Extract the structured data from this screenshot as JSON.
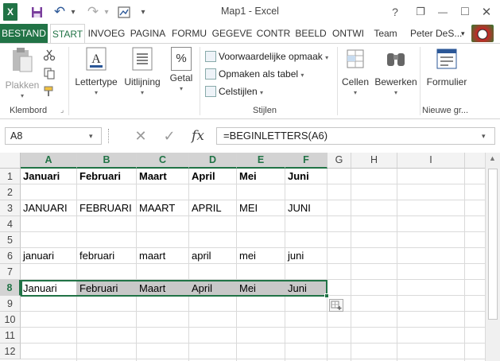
{
  "window": {
    "title": "Map1 - Excel",
    "help": "?",
    "restore": "❐",
    "minimize": "—",
    "maximize": "□",
    "close": "✕"
  },
  "qat": {
    "logo": "X",
    "undo": "↶",
    "undo_caret": "▾",
    "redo": "↷",
    "redo_caret": "▾",
    "customize": "▾"
  },
  "tabs": [
    {
      "label": "BESTAND"
    },
    {
      "label": "START"
    },
    {
      "label": "INVOEG"
    },
    {
      "label": "PAGINA"
    },
    {
      "label": "FORMU"
    },
    {
      "label": "GEGEVE"
    },
    {
      "label": "CONTR"
    },
    {
      "label": "BEELD"
    },
    {
      "label": "ONTWI"
    },
    {
      "label": "Team"
    }
  ],
  "user": {
    "name": "Peter DeS...",
    "caret": "▾"
  },
  "ribbon": {
    "groups": {
      "klembord": "Klembord",
      "stijlen": "Stijlen",
      "nieuwe": "Nieuwe gr..."
    },
    "plakken": "Plakken",
    "lettertype": "Lettertype",
    "uitlijning": "Uitlijning",
    "getal": "Getal",
    "getal_icon_text": "%",
    "voorwaardelijk": "Voorwaardelijke opmaak",
    "opmaken": "Opmaken als tabel",
    "celstijlen": "Celstijlen",
    "cellen": "Cellen",
    "bewerken": "Bewerken",
    "formulier": "Formulier",
    "caret": "▾"
  },
  "formula_bar": {
    "name_box": "A8",
    "formula": "=BEGINLETTERS(A6)",
    "cancel": "✕",
    "enter": "✓",
    "fx": "fx",
    "caret": "▾"
  },
  "grid": {
    "columns": [
      "A",
      "B",
      "C",
      "D",
      "E",
      "F",
      "G",
      "H",
      "I"
    ],
    "rows": [
      "1",
      "2",
      "3",
      "4",
      "5",
      "6",
      "7",
      "8",
      "9",
      "10",
      "11",
      "12"
    ],
    "selected_cell": "A8",
    "cells": {
      "r1": [
        "Januari",
        "Februari",
        "Maart",
        "April",
        "Mei",
        "Juni"
      ],
      "r3": [
        "JANUARI",
        "FEBRUARI",
        "MAART",
        "APRIL",
        "MEI",
        "JUNI"
      ],
      "r6": [
        "januari",
        "februari",
        "maart",
        "april",
        "mei",
        "juni"
      ],
      "r8": [
        "Januari",
        "Februari",
        "Maart",
        "April",
        "Mei",
        "Juni"
      ]
    }
  },
  "colors": {
    "accent": "#217346",
    "selection_fill": "#c8c8c8"
  }
}
